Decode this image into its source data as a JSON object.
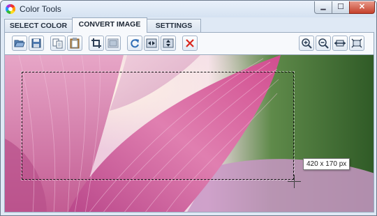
{
  "window": {
    "title": "Color Tools",
    "controls": {
      "minimize": "▁",
      "maximize": "☐",
      "close": "✕"
    }
  },
  "tabs": [
    {
      "label": "SELECT COLOR",
      "active": false
    },
    {
      "label": "CONVERT IMAGE",
      "active": true
    },
    {
      "label": "SETTINGS",
      "active": false
    }
  ],
  "toolbar": {
    "icons": [
      "open-icon",
      "save-icon",
      "copy-icon",
      "paste-icon",
      "crop-icon",
      "resize-icon",
      "rotate-icon",
      "flip-horizontal-icon",
      "flip-vertical-icon",
      "delete-icon",
      "zoom-in-icon",
      "zoom-out-icon",
      "fit-width-icon",
      "fit-window-icon"
    ],
    "colors": {
      "delete": "#d9261c",
      "accent": "#2f6db5"
    }
  },
  "canvas": {
    "image_subject": "pink lotus petal close-up",
    "selection_size_label": "420 x 170 px"
  }
}
